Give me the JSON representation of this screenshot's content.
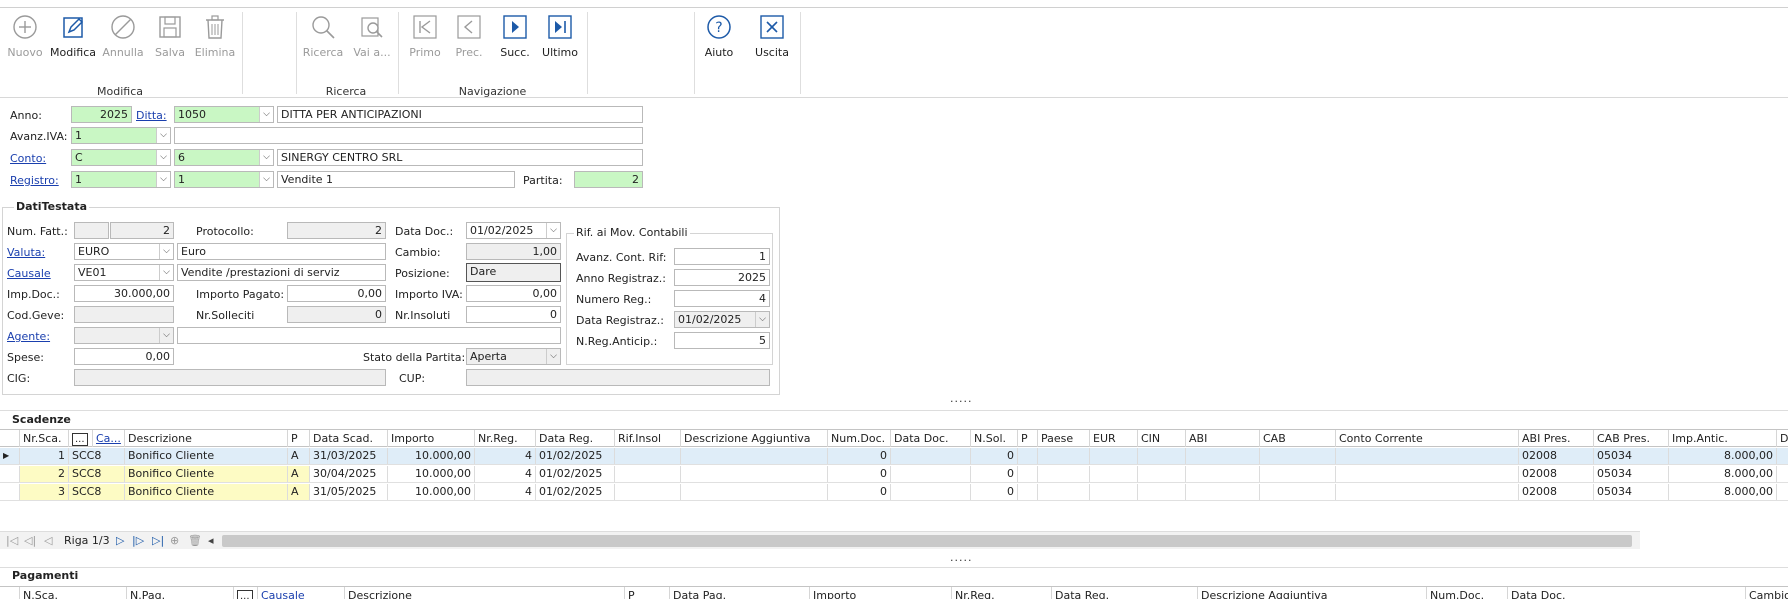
{
  "ribbon": {
    "buttons": [
      {
        "label": "Nuovo",
        "icon": "plus-circle-icon",
        "enabled": false
      },
      {
        "label": "Modifica",
        "icon": "edit-icon",
        "enabled": true
      },
      {
        "label": "Annulla",
        "icon": "cancel-circle-icon",
        "enabled": false
      },
      {
        "label": "Salva",
        "icon": "save-icon",
        "enabled": false
      },
      {
        "label": "Elimina",
        "icon": "trash-icon",
        "enabled": false
      },
      {
        "label": "Ricerca",
        "icon": "search-icon",
        "enabled": false
      },
      {
        "label": "Vai a...",
        "icon": "goto-search-icon",
        "enabled": false
      },
      {
        "label": "Primo",
        "icon": "first-icon",
        "enabled": false
      },
      {
        "label": "Prec.",
        "icon": "prev-icon",
        "enabled": false
      },
      {
        "label": "Succ.",
        "icon": "next-icon",
        "enabled": true
      },
      {
        "label": "Ultimo",
        "icon": "last-icon",
        "enabled": true
      },
      {
        "label": "Aiuto",
        "icon": "help-icon",
        "enabled": true
      },
      {
        "label": "Uscita",
        "icon": "exit-icon",
        "enabled": true
      }
    ],
    "groups": {
      "modifica": "Modifica",
      "ricerca": "Ricerca",
      "navigazione": "Navigazione"
    }
  },
  "header": {
    "anno_label": "Anno:",
    "anno": "2025",
    "ditta_label": "Ditta:",
    "ditta_code": "1050",
    "ditta_name": "DITTA PER ANTICIPAZIONI",
    "avanz_iva_label": "Avanz.IVA:",
    "avanz_iva": "1",
    "conto_label": "Conto:",
    "conto_type": "C",
    "conto_code": "6",
    "conto_name": "SINERGY CENTRO SRL",
    "registro_label": "Registro:",
    "registro_1": "1",
    "registro_2": "1",
    "registro_name": "Vendite 1",
    "partita_label": "Partita:",
    "partita": "2"
  },
  "dati_testata": {
    "title": "DatiTestata",
    "num_fatt_label": "Num. Fatt.:",
    "num_fatt": "2",
    "protocollo_label": "Protocollo:",
    "protocollo": "2",
    "data_doc_label": "Data Doc.:",
    "data_doc": "01/02/2025",
    "valuta_label": "Valuta:",
    "valuta": "EURO",
    "valuta_desc": "Euro",
    "cambio_label": "Cambio:",
    "cambio": "1,00",
    "causale_label": "Causale",
    "causale": "VE01",
    "causale_desc": "Vendite /prestazioni di serviz",
    "posizione_label": "Posizione:",
    "posizione": "Dare",
    "imp_doc_label": "Imp.Doc.:",
    "imp_doc": "30.000,00",
    "importo_pagato_label": "Importo Pagato:",
    "importo_pagato": "0,00",
    "importo_iva_label": "Importo IVA:",
    "importo_iva": "0,00",
    "cod_geve_label": "Cod.Geve:",
    "nr_solleciti_label": "Nr.Solleciti",
    "nr_solleciti": "0",
    "nr_insoluti_label": "Nr.Insoluti",
    "nr_insoluti": "0",
    "agente_label": "Agente:",
    "spese_label": "Spese:",
    "spese": "0,00",
    "stato_label": "Stato della Partita:",
    "stato": "Aperta",
    "cig_label": "CIG:",
    "cup_label": "CUP:"
  },
  "rif_mov": {
    "title": "Rif. ai Mov. Contabili",
    "avanz_label": "Avanz. Cont. Rif:",
    "avanz": "1",
    "anno_label": "Anno Registraz.:",
    "anno": "2025",
    "numero_label": "Numero Reg.:",
    "numero": "4",
    "data_label": "Data Registraz.:",
    "data": "01/02/2025",
    "nreg_label": "N.Reg.Anticip.:",
    "nreg": "5"
  },
  "splitter": ".....",
  "scadenze": {
    "title": "Scadenze",
    "columns": [
      "Nr.Sca.",
      "...",
      "Ca...",
      "Descrizione",
      "P",
      "Data Scad.",
      "Importo",
      "Nr.Reg.",
      "Data Reg.",
      "Rif.Insol",
      "Descrizione Aggiuntiva",
      "Num.Doc.",
      "Data Doc.",
      "N.Sol.",
      "P",
      "Paese",
      "EUR",
      "CIN",
      "ABI",
      "CAB",
      "Conto Corrente",
      "ABI Pres.",
      "CAB Pres.",
      "Imp.Antic.",
      "Da"
    ],
    "rows": [
      {
        "nr": "1",
        "ca": "SCC8",
        "descr": "Bonifico Cliente",
        "p": "A",
        "data_scad": "31/03/2025",
        "importo": "10.000,00",
        "nr_reg": "4",
        "data_reg": "01/02/2025",
        "num_doc": "0",
        "n_sol": "0",
        "abi_pres": "02008",
        "cab_pres": "05034",
        "imp_antic": "8.000,00"
      },
      {
        "nr": "2",
        "ca": "SCC8",
        "descr": "Bonifico Cliente",
        "p": "A",
        "data_scad": "30/04/2025",
        "importo": "10.000,00",
        "nr_reg": "4",
        "data_reg": "01/02/2025",
        "num_doc": "0",
        "n_sol": "0",
        "abi_pres": "02008",
        "cab_pres": "05034",
        "imp_antic": "8.000,00"
      },
      {
        "nr": "3",
        "ca": "SCC8",
        "descr": "Bonifico Cliente",
        "p": "A",
        "data_scad": "31/05/2025",
        "importo": "10.000,00",
        "nr_reg": "4",
        "data_reg": "01/02/2025",
        "num_doc": "0",
        "n_sol": "0",
        "abi_pres": "02008",
        "cab_pres": "05034",
        "imp_antic": "8.000,00"
      }
    ],
    "row_status": "Riga 1/3"
  },
  "pagamenti": {
    "title": "Pagamenti",
    "columns": [
      "N.Sca.",
      "N.Pag.",
      "...",
      "Causale",
      "Descrizione",
      "P",
      "Data Pag.",
      "Importo",
      "Nr.Reg.",
      "Data Reg.",
      "Descrizione Aggiuntiva",
      "Num.Doc.",
      "Data Doc.",
      "Cambio"
    ]
  }
}
